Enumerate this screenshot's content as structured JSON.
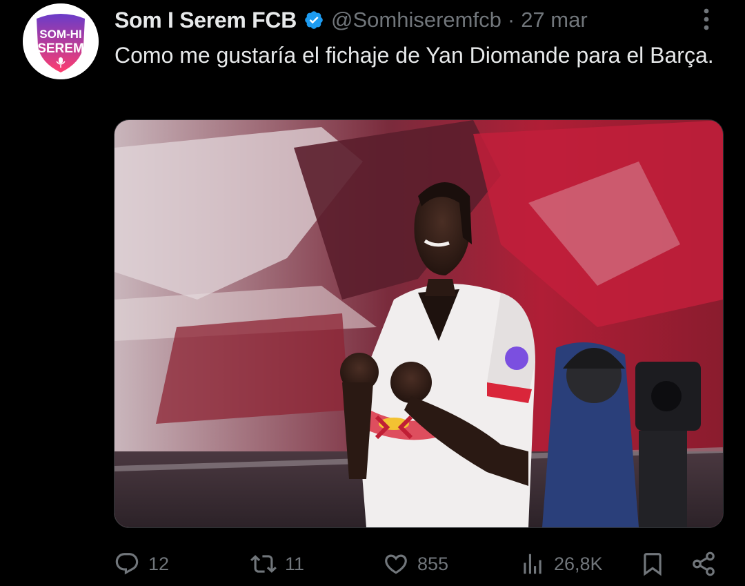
{
  "tweet": {
    "avatar_text_line1": "SOM-HI",
    "avatar_text_line2": "SEREM",
    "display_name": "Som I Serem FCB",
    "handle": "@Somhiseremfcb",
    "separator": "·",
    "date": "27 mar",
    "text": "Como me gustaría el fichaje de Yan Diomande para el Barça.",
    "media": {
      "icon": "photo",
      "description_shown": false
    }
  },
  "actions": {
    "replies": {
      "icon": "reply-icon",
      "count": "12"
    },
    "retweets": {
      "icon": "retweet-icon",
      "count": "11"
    },
    "likes": {
      "icon": "heart-icon",
      "count": "855"
    },
    "views": {
      "icon": "views-icon",
      "count": "26,8K"
    },
    "bookmark": {
      "icon": "bookmark-icon"
    },
    "share": {
      "icon": "share-icon"
    }
  },
  "colors": {
    "background": "#000000",
    "text": "#e7e9ea",
    "muted": "#71767b",
    "verified": "#1d9bf0",
    "avatar_gradient_top": "#6a3cc9",
    "avatar_gradient_bottom": "#ff3d6e"
  }
}
